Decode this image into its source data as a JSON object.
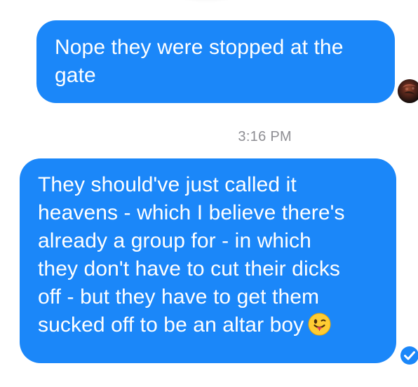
{
  "conversation": {
    "messages": [
      {
        "lines": [
          "Nope they were stopped at the",
          "gate"
        ],
        "sender_avatar": "profile-avatar"
      },
      {
        "timestamp": "3:16 PM",
        "lines": [
          "They should've just called it",
          "heavens - which I believe there's",
          "already a group for - in which",
          "they don't have to cut their dicks",
          "off - but they have to get them",
          "sucked off to be an altar boy"
        ],
        "emoji": "tongue-wink-emoji",
        "status_icon": "delivered-check-icon"
      }
    ]
  },
  "colors": {
    "bubble": "#1b87f9",
    "bubble_text": "#ffffff",
    "timestamp_text": "#8e8e93",
    "background": "#ffffff"
  }
}
